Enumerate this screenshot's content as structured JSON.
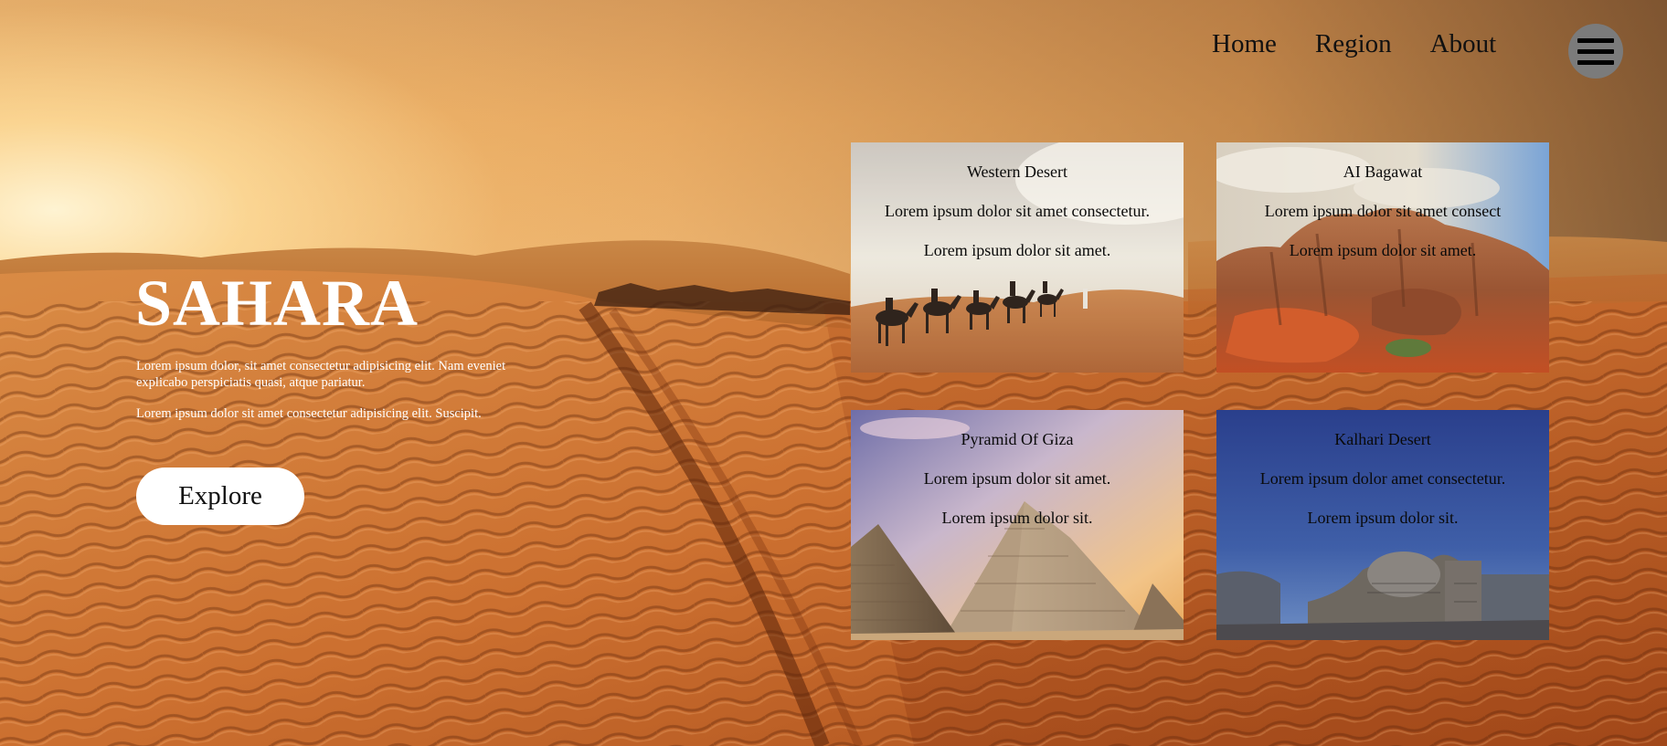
{
  "nav": {
    "links": [
      "Home",
      "Region",
      "About"
    ]
  },
  "hero": {
    "title": "SAHARA",
    "paragraph1": "Lorem ipsum dolor, sit amet consectetur adipisicing elit. Nam eveniet explicabo perspiciatis quasi, atque pariatur.",
    "paragraph2": "Lorem ipsum dolor sit amet consectetur adipisicing elit. Suscipit.",
    "button_label": "Explore"
  },
  "cards": [
    {
      "title": "Western Desert",
      "line1": "Lorem ipsum dolor sit amet consectetur.",
      "line2": "Lorem ipsum dolor sit amet."
    },
    {
      "title": "AI Bagawat",
      "line1": "Lorem ipsum dolor sit amet consect",
      "line2": "Lorem ipsum dolor sit amet."
    },
    {
      "title": "Pyramid Of Giza",
      "line1": "Lorem ipsum dolor sit amet.",
      "line2": "Lorem ipsum dolor sit."
    },
    {
      "title": "Kalhari Desert",
      "line1": "Lorem ipsum dolor amet consectetur.",
      "line2": "Lorem ipsum dolor sit."
    }
  ],
  "icons": {
    "menu": "hamburger-menu-icon"
  },
  "colors": {
    "menu_button": "#7b7b7b",
    "hero_text": "#ffffff",
    "button_bg": "#ffffff"
  }
}
